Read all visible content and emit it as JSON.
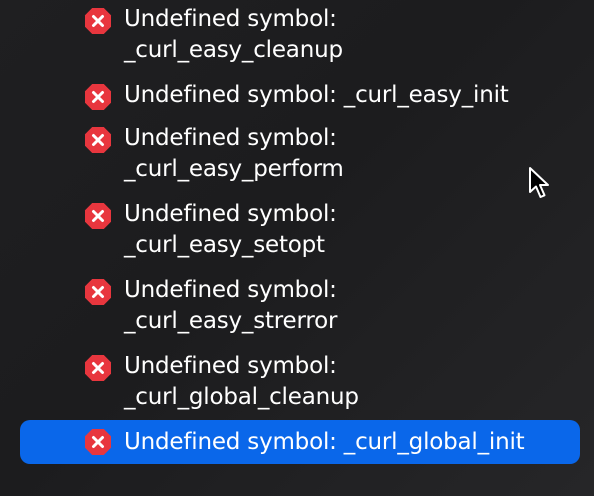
{
  "issues": [
    {
      "line1": "Undefined symbol:",
      "line2": "_curl_easy_cleanup",
      "icon": "error-icon",
      "selected": false
    },
    {
      "line1": "Undefined symbol: _curl_easy_init",
      "line2": "",
      "icon": "error-icon",
      "selected": false
    },
    {
      "line1": "Undefined symbol:",
      "line2": "_curl_easy_perform",
      "icon": "error-icon",
      "selected": false
    },
    {
      "line1": "Undefined symbol:",
      "line2": "_curl_easy_setopt",
      "icon": "error-icon",
      "selected": false
    },
    {
      "line1": "Undefined symbol:",
      "line2": "_curl_easy_strerror",
      "icon": "error-icon",
      "selected": false
    },
    {
      "line1": "Undefined symbol:",
      "line2": "_curl_global_cleanup",
      "icon": "error-icon",
      "selected": false
    },
    {
      "line1": "Undefined symbol: _curl_global_init",
      "line2": "",
      "icon": "error-icon",
      "selected": true
    }
  ],
  "colors": {
    "error": "#e8363e",
    "selection": "#0a67ea",
    "background": "#1e1e20",
    "text": "#ffffff"
  }
}
